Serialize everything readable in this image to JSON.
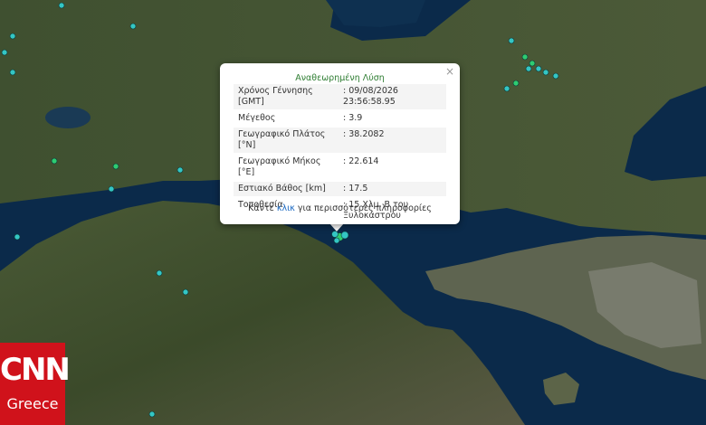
{
  "popup": {
    "title": "Αναθεωρημένη Λύση",
    "close": "×",
    "rows": [
      {
        "label": "Χρόνος Γέννησης [GMT]",
        "value": ": 09/08/2026 23:56:58.95"
      },
      {
        "label": "Μέγεθος",
        "value": ": 3.9"
      },
      {
        "label": "Γεωγραφικό Πλάτος [°N]",
        "value": ": 38.2082"
      },
      {
        "label": "Γεωγραφικό Μήκος [°E]",
        "value": ": 22.614"
      },
      {
        "label": "Εστιακό Βάθος [km]",
        "value": ": 17.5"
      },
      {
        "label": "Τοποθεσία",
        "value": ": 15 Χλμ. Β του Ξυλοκάστρου"
      }
    ],
    "more_before": "Κάντε ",
    "more_link": "κλικ",
    "more_after": " για περισσότερες πληροφορίες"
  },
  "logo": {
    "line1": "CNN",
    "line2": "Greece"
  },
  "colors": {
    "sea": "#0b2a4a",
    "land": "#3e4f2e",
    "marker": "#34c6c4",
    "marker_green": "#2ecc71",
    "logo_bg": "#d0121b",
    "title_green": "#2e7d32"
  }
}
